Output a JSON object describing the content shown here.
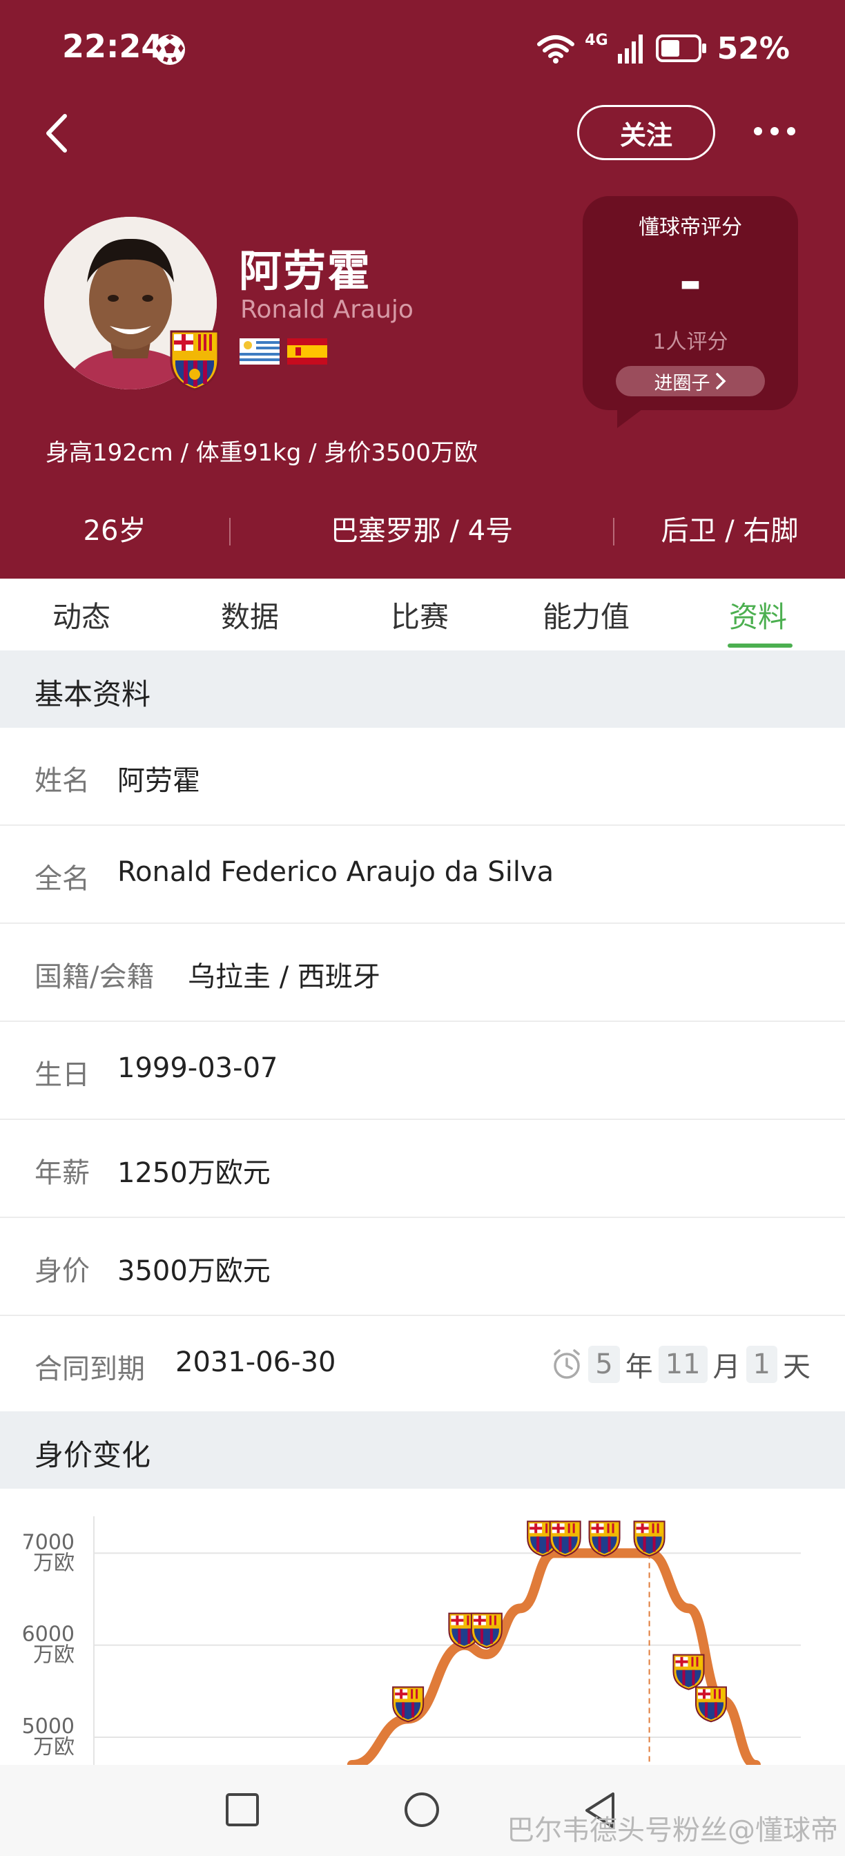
{
  "status_bar": {
    "time": "22:24",
    "network": "4G",
    "battery": "52%",
    "battery_level": 0.52
  },
  "header": {
    "follow_label": "关注",
    "player_name_cn": "阿劳霍",
    "player_name_en": "Ronald Araujo",
    "body_stats": "身高192cm / 体重91kg / 身价3500万欧",
    "age": "26岁",
    "club_number": "巴塞罗那 / 4号",
    "position_foot": "后卫 / 右脚"
  },
  "rating": {
    "title": "懂球帝评分",
    "score": "-",
    "count": "1人评分",
    "circle_button": "进圈子"
  },
  "tabs": [
    {
      "label": "动态"
    },
    {
      "label": "数据"
    },
    {
      "label": "比赛"
    },
    {
      "label": "能力值"
    },
    {
      "label": "资料"
    }
  ],
  "active_tab": "资料",
  "basic_info": {
    "title": "基本资料",
    "rows": [
      {
        "label": "姓名",
        "value": "阿劳霍"
      },
      {
        "label": "全名",
        "value": "Ronald Federico Araujo da Silva"
      },
      {
        "label": "国籍/会籍",
        "value": "乌拉圭 / 西班牙"
      },
      {
        "label": "生日",
        "value": "1999-03-07"
      },
      {
        "label": "年薪",
        "value": "1250万欧元"
      },
      {
        "label": "身价",
        "value": "3500万欧元"
      },
      {
        "label": "合同到期",
        "value": "2031-06-30"
      }
    ],
    "countdown": {
      "years": "5",
      "year_unit": "年",
      "months": "11",
      "month_unit": "月",
      "days": "1",
      "day_unit": "天"
    }
  },
  "value_section": {
    "title": "身价变化"
  },
  "chart_data": {
    "type": "line",
    "y_tick_labels": [
      {
        "value": 7000,
        "line1": "7000",
        "line2": "万欧"
      },
      {
        "value": 6000,
        "line1": "6000",
        "line2": "万欧"
      },
      {
        "value": 5000,
        "line1": "5000",
        "line2": "万欧"
      }
    ],
    "ylim": [
      4700,
      7400
    ],
    "series_color": "#e07b39",
    "grid": true,
    "points": [
      {
        "x": 0.0,
        "y": 4700
      },
      {
        "x": 1.0,
        "y": 5200
      },
      {
        "x": 2.0,
        "y": 6000
      },
      {
        "x": 2.4,
        "y": 5900
      },
      {
        "x": 3.0,
        "y": 6400
      },
      {
        "x": 3.6,
        "y": 7000
      },
      {
        "x": 5.3,
        "y": 7000
      },
      {
        "x": 6.0,
        "y": 6400
      },
      {
        "x": 6.6,
        "y": 5400
      },
      {
        "x": 7.2,
        "y": 4700
      }
    ],
    "markers": [
      {
        "x": 1.0,
        "y": 5200
      },
      {
        "x": 2.0,
        "y": 6000
      },
      {
        "x": 2.4,
        "y": 6000
      },
      {
        "x": 3.4,
        "y": 7000
      },
      {
        "x": 3.8,
        "y": 7000
      },
      {
        "x": 4.5,
        "y": 7000
      },
      {
        "x": 5.3,
        "y": 7000
      },
      {
        "x": 6.0,
        "y": 5550
      },
      {
        "x": 6.4,
        "y": 5200
      }
    ],
    "xlim": [
      -4.6,
      8.0
    ],
    "current_marker_x": 5.3
  },
  "nav": {
    "watermark": "巴尔韦德头号粉丝@懂球帝"
  }
}
